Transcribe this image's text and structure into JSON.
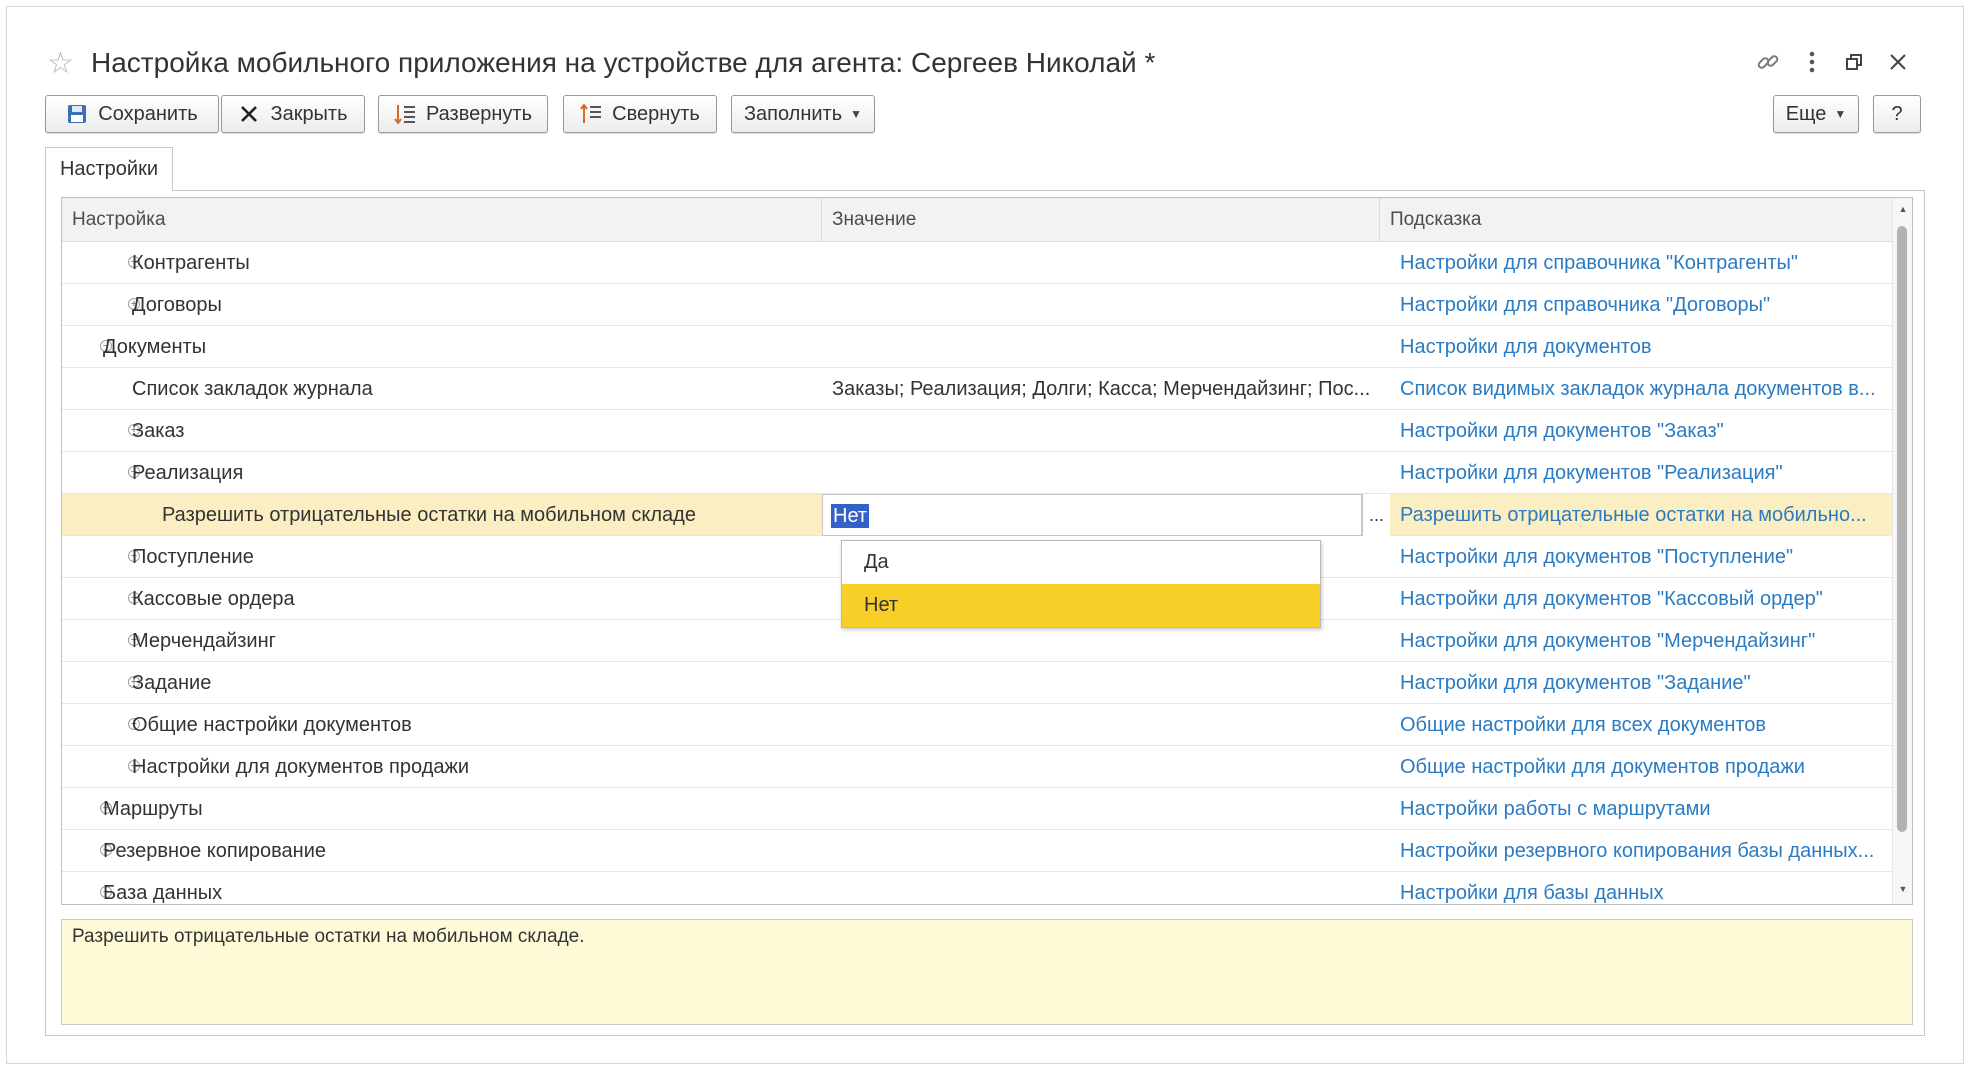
{
  "window": {
    "title": "Настройка мобильного приложения на устройстве для агента: Сергеев Николай *",
    "controls": {
      "link": "link-icon",
      "more": "more-icon",
      "restore": "restore-icon",
      "close": "close-icon"
    }
  },
  "toolbar": {
    "save": "Сохранить",
    "close": "Закрыть",
    "expand": "Развернуть",
    "collapse": "Свернуть",
    "fill": "Заполнить",
    "more": "Еще",
    "help": "?"
  },
  "tabs": [
    {
      "label": "Настройки",
      "active": true
    }
  ],
  "grid": {
    "columns": [
      "Настройка",
      "Значение",
      "Подсказка"
    ],
    "rows": [
      {
        "name": "Контрагенты",
        "value": "",
        "hint": "Настройки для справочника \"Контрагенты\"",
        "level": 1,
        "toggle": "plus"
      },
      {
        "name": "Договоры",
        "value": "",
        "hint": "Настройки для справочника \"Договоры\"",
        "level": 1,
        "toggle": "plus"
      },
      {
        "name": "Документы",
        "value": "",
        "hint": "Настройки для документов",
        "level": 0,
        "toggle": "minus"
      },
      {
        "name": "Список закладок журнала",
        "value": "Заказы; Реализация; Долги; Касса; Мерчендайзинг; Пос...",
        "hint": "Список видимых закладок журнала документов в...",
        "level": 1,
        "toggle": ""
      },
      {
        "name": "Заказ",
        "value": "",
        "hint": "Настройки для документов \"Заказ\"",
        "level": 1,
        "toggle": "plus"
      },
      {
        "name": "Реализация",
        "value": "",
        "hint": "Настройки для документов \"Реализация\"",
        "level": 1,
        "toggle": "minus"
      },
      {
        "name": "Разрешить отрицательные остатки на мобильном складе",
        "value": "Нет",
        "hint": "Разрешить отрицательные остатки на мобильно...",
        "level": 2,
        "toggle": "",
        "selected": true
      },
      {
        "name": "Поступление",
        "value": "",
        "hint": "Настройки для документов \"Поступление\"",
        "level": 1,
        "toggle": "plus"
      },
      {
        "name": "Кассовые ордера",
        "value": "",
        "hint": "Настройки для документов \"Кассовый ордер\"",
        "level": 1,
        "toggle": "plus"
      },
      {
        "name": "Мерчендайзинг",
        "value": "",
        "hint": "Настройки для документов \"Мерчендайзинг\"",
        "level": 1,
        "toggle": "plus"
      },
      {
        "name": "Задание",
        "value": "",
        "hint": "Настройки для документов \"Задание\"",
        "level": 1,
        "toggle": "plus"
      },
      {
        "name": "Общие настройки документов",
        "value": "",
        "hint": "Общие настройки для всех документов",
        "level": 1,
        "toggle": "plus"
      },
      {
        "name": "Настройки для документов продажи",
        "value": "",
        "hint": "Общие настройки для документов продажи",
        "level": 1,
        "toggle": "plus"
      },
      {
        "name": "Маршруты",
        "value": "",
        "hint": "Настройки работы с маршрутами",
        "level": 0,
        "toggle": "plus"
      },
      {
        "name": "Резервное копирование",
        "value": "",
        "hint": "Настройки резервного копирования базы данных...",
        "level": 0,
        "toggle": "plus"
      },
      {
        "name": "База данных",
        "value": "",
        "hint": "Настройки для базы данных",
        "level": 0,
        "toggle": "plus"
      }
    ]
  },
  "dropdown": {
    "options": [
      "Да",
      "Нет"
    ],
    "active": "Нет"
  },
  "hint_panel": {
    "text": "Разрешить отрицательные остатки на мобильном складе."
  },
  "colors": {
    "link": "#2b7bc2",
    "selected_row": "#fbeec2",
    "dropdown_active": "#f7cf27",
    "hint_bg": "#fffbd9",
    "text_selection": "#3361c8"
  }
}
